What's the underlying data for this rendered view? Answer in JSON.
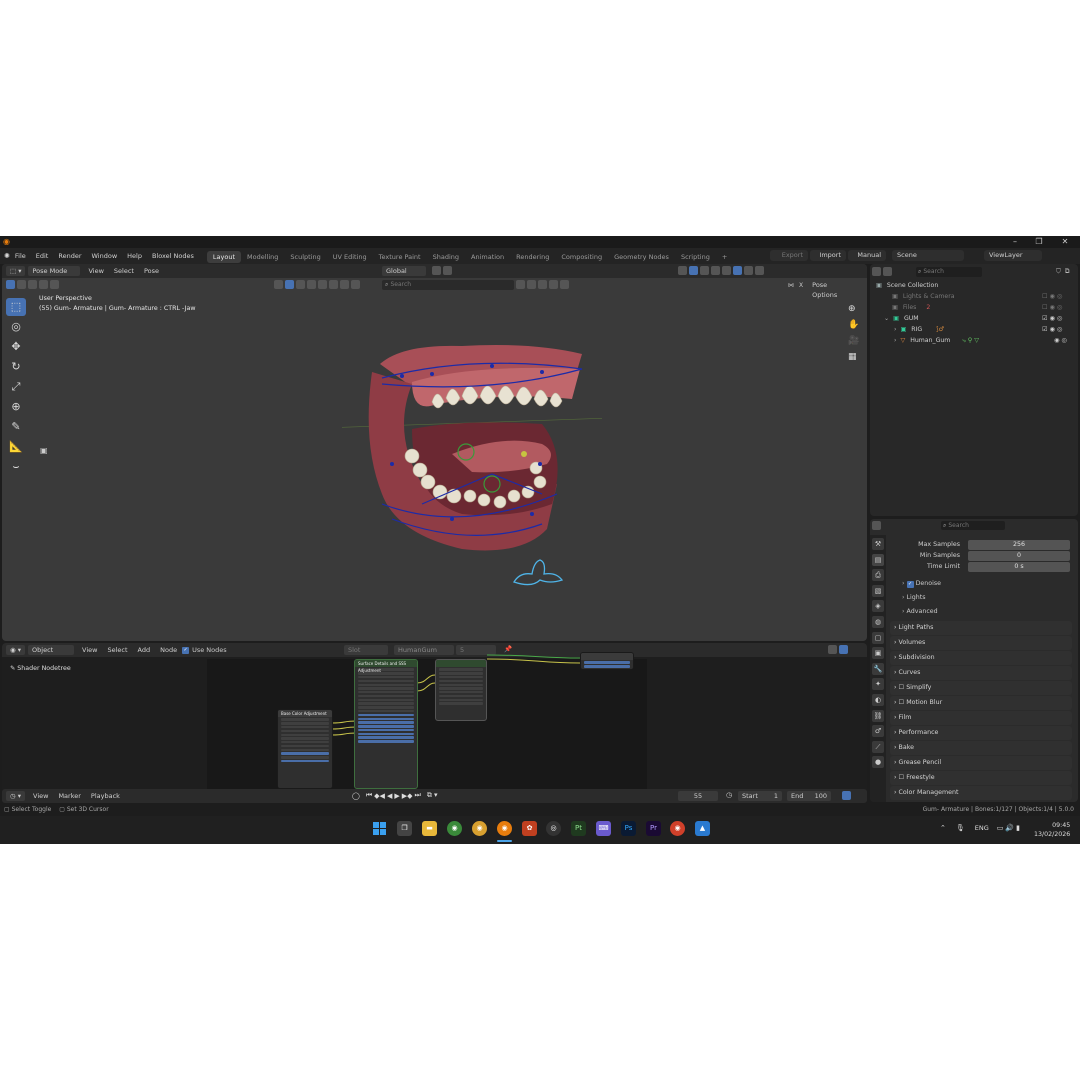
{
  "title_bar": {
    "logo_icon": "blender-logo-icon",
    "min_icon": "minimize-icon",
    "max_icon": "maximize-icon",
    "close_icon": "close-icon"
  },
  "menu": {
    "items": [
      "File",
      "Edit",
      "Render",
      "Window",
      "Help",
      "Bloxel Nodes"
    ],
    "workspaces": [
      "Layout",
      "Modelling",
      "Sculpting",
      "UV Editing",
      "Texture Paint",
      "Shading",
      "Animation",
      "Rendering",
      "Compositing",
      "Geometry Nodes",
      "Scripting"
    ],
    "active_workspace": "Layout",
    "add_tab": "+",
    "export_label": "Export",
    "import_label": "Import",
    "manual_label": "Manual",
    "scene": "Scene",
    "view_layer": "ViewLayer"
  },
  "viewport": {
    "mode": "Pose Mode",
    "menus": [
      "View",
      "Select",
      "Pose"
    ],
    "transform_orientation": "Global",
    "search_placeholder": "Search",
    "x_label": "X",
    "pose_options": "Pose Options",
    "overlay_title": "User Perspective",
    "overlay_subtitle": "(55) Gum- Armature | Gum- Armature : CTRL -Jaw"
  },
  "outliner": {
    "search_placeholder": "Search",
    "rows": [
      {
        "label": "Scene Collection",
        "indent": 0
      },
      {
        "label": "Lights & Camera",
        "indent": 1
      },
      {
        "label": "Files",
        "indent": 1
      },
      {
        "label": "GUM",
        "indent": 1
      },
      {
        "label": "RIG",
        "indent": 2
      },
      {
        "label": "Human_Gum",
        "indent": 2
      }
    ],
    "files_count": "2"
  },
  "properties": {
    "search_placeholder": "Search",
    "fields": [
      {
        "label": "Max Samples",
        "value": "256"
      },
      {
        "label": "Min Samples",
        "value": "0"
      },
      {
        "label": "Time Limit",
        "value": "0 s"
      }
    ],
    "sub_panels": [
      "Denoise",
      "Lights",
      "Advanced"
    ],
    "denoise_checked": true,
    "panels": [
      "Light Paths",
      "Volumes",
      "Subdivision",
      "Curves",
      "Simplify",
      "Motion Blur",
      "Film",
      "Performance",
      "Bake",
      "Grease Pencil",
      "Freestyle",
      "Color Management"
    ]
  },
  "node_editor": {
    "type": "Object",
    "menus": [
      "View",
      "Select",
      "Add",
      "Node"
    ],
    "use_nodes_label": "Use Nodes",
    "slot_label": "Slot",
    "material_name": "HumanGum",
    "material_users": "5",
    "tree_label": "Shader Nodetree",
    "node_titles": [
      "Base Color Adjustment",
      "Surface Details and SSS Adjustment"
    ]
  },
  "timeline": {
    "menus": [
      "View",
      "Marker",
      "Playback"
    ],
    "current_frame": "55",
    "start_label": "Start",
    "start_value": "1",
    "end_label": "End",
    "end_value": "100"
  },
  "status_bar": {
    "left_1": "Select Toggle",
    "left_2": "Set 3D Cursor",
    "right": "Gum- Armature | Bones:1/127 | Objects:1/4 | 5.0.0"
  },
  "taskbar": {
    "language": "ENG",
    "time": "09:45",
    "date": "13/02/2026",
    "app_icons": [
      "windows-start-icon",
      "task-view-icon",
      "file-explorer-icon",
      "chrome-icon",
      "chrome-profile-icon",
      "blender-icon",
      "davinci-resolve-icon",
      "obs-icon",
      "substance-painter-icon",
      "vs-code-icon",
      "photoshop-icon",
      "premiere-pro-icon",
      "screen-recorder-icon",
      "image-viewer-icon"
    ],
    "app_labels": [
      "Pt",
      "Ps",
      "Pr"
    ]
  },
  "colors": {
    "accent": "#4772b3",
    "viewport_bg": "#3a3a3a",
    "gum": "#b85c62",
    "bone_outline": "#1c2ba8"
  }
}
